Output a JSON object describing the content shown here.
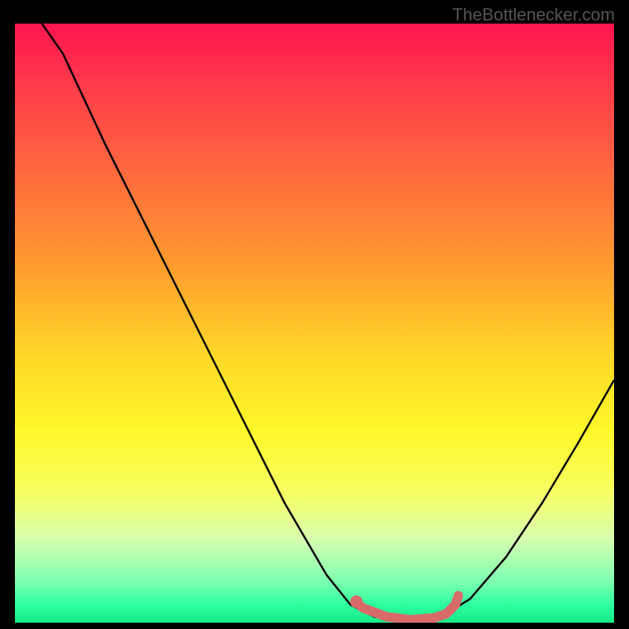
{
  "watermark": "TheBottlenecker.com",
  "chart_data": {
    "type": "line",
    "title": "",
    "xlabel": "",
    "ylabel": "",
    "xlim": [
      0,
      100
    ],
    "ylim": [
      0,
      100
    ],
    "series": [
      {
        "name": "curve",
        "color": "#000000",
        "points": [
          [
            4.5,
            100
          ],
          [
            8,
            95
          ],
          [
            15,
            80
          ],
          [
            25,
            60
          ],
          [
            35,
            40
          ],
          [
            45,
            20
          ],
          [
            52,
            8
          ],
          [
            56,
            3
          ],
          [
            60,
            1
          ],
          [
            64,
            0.5
          ],
          [
            68,
            0.5
          ],
          [
            72,
            1.5
          ],
          [
            76,
            4
          ],
          [
            82,
            11
          ],
          [
            88,
            20
          ],
          [
            94,
            30
          ],
          [
            100,
            40.5
          ]
        ]
      },
      {
        "name": "highlight",
        "color": "#d96a6a",
        "points": [
          [
            57,
            3.5
          ],
          [
            58,
            2.5
          ],
          [
            62,
            1
          ],
          [
            66,
            0.5
          ],
          [
            70,
            0.8
          ],
          [
            72,
            1.5
          ],
          [
            73.5,
            3
          ],
          [
            74,
            4.5
          ]
        ]
      }
    ],
    "background_gradient": {
      "top": "#ff1550",
      "mid1": "#ff9a2f",
      "mid2": "#fff82a",
      "bottom": "#15e986"
    }
  }
}
